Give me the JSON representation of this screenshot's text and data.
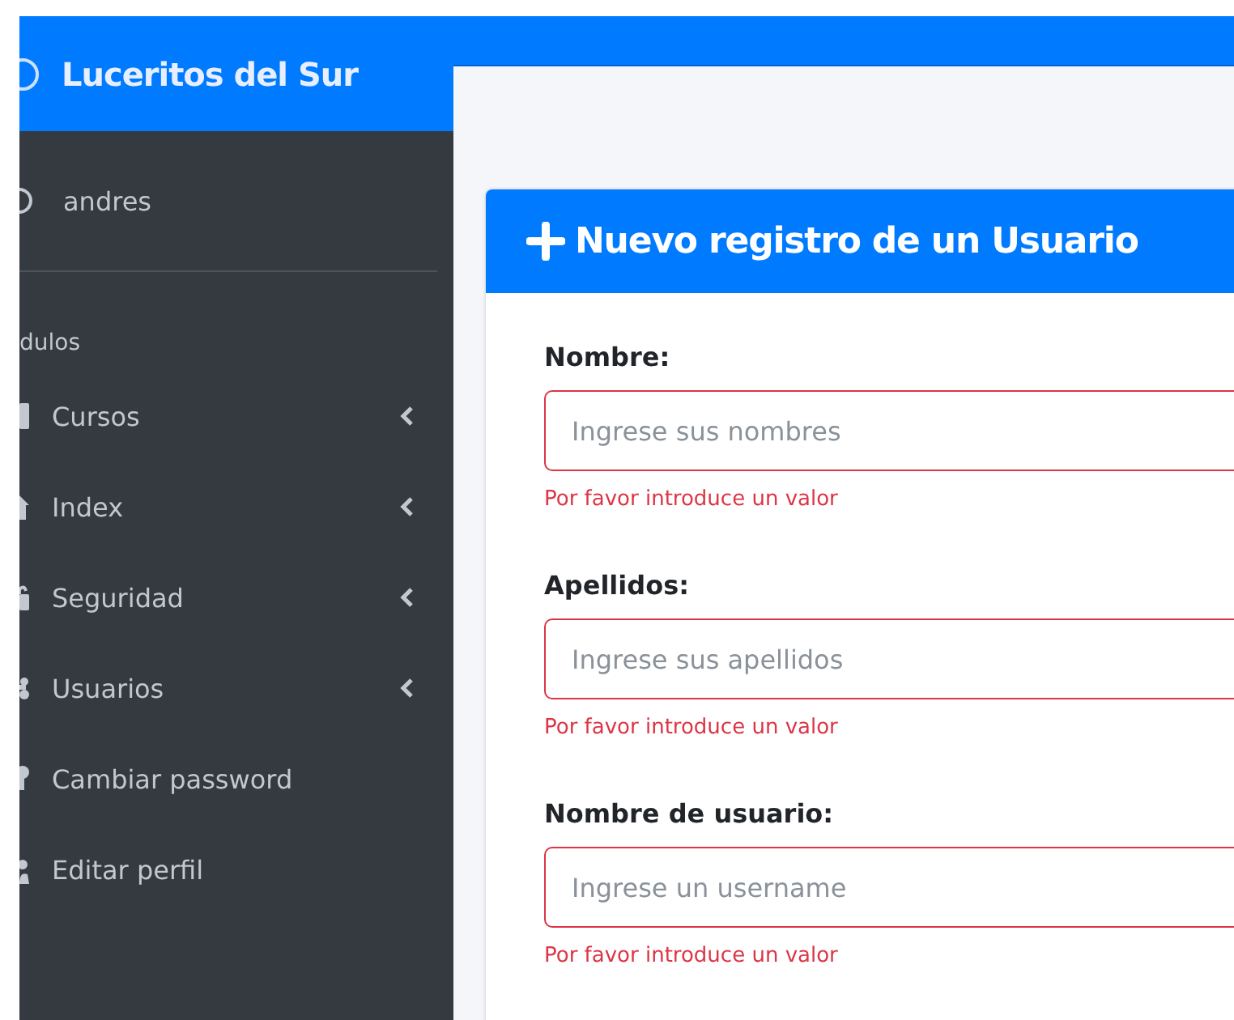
{
  "sidebar": {
    "brand": "Luceritos del Sur",
    "user": "andres",
    "section_header": "dulos",
    "items": [
      {
        "label": "Cursos",
        "kind": "submenu",
        "expanded": false
      },
      {
        "label": "Index",
        "kind": "submenu",
        "expanded": false
      },
      {
        "label": "Seguridad",
        "kind": "submenu",
        "expanded": false
      },
      {
        "label": "Usuarios",
        "kind": "submenu",
        "expanded": false
      },
      {
        "label": "Cambiar password",
        "kind": "link"
      },
      {
        "label": "Editar perfil",
        "kind": "link"
      }
    ]
  },
  "form": {
    "title": "Nuevo registro de un Usuario",
    "fields": [
      {
        "label": "Nombre:",
        "placeholder": "Ingrese sus nombres",
        "invalid": true,
        "error": "Por favor introduce un valor"
      },
      {
        "label": "Apellidos:",
        "placeholder": "Ingrese sus apellidos",
        "invalid": true,
        "error": "Por favor introduce un valor"
      },
      {
        "label": "Nombre de usuario:",
        "placeholder": "Ingrese un username",
        "invalid": true,
        "error": "Por favor introduce un valor"
      }
    ]
  }
}
